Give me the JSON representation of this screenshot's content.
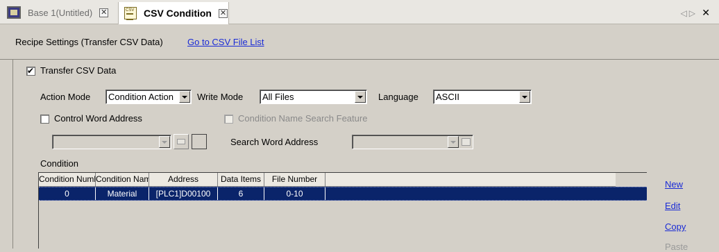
{
  "tabs": [
    {
      "label": "Base 1(Untitled)",
      "icon": "monitor-icon",
      "active": false
    },
    {
      "label": "CSV Condition",
      "icon": "csv-document-icon",
      "active": true
    }
  ],
  "nav": {
    "left": "◁",
    "right": "▷",
    "close": "✕"
  },
  "header": {
    "title": "Recipe Settings (Transfer CSV Data)",
    "link": "Go to CSV File List"
  },
  "transfer_csv": {
    "label": "Transfer CSV Data",
    "checked": true
  },
  "action_mode": {
    "label": "Action Mode",
    "value": "Condition Action"
  },
  "write_mode": {
    "label": "Write Mode",
    "value": "All Files"
  },
  "language": {
    "label": "Language",
    "value": "ASCII"
  },
  "control_word": {
    "label": "Control Word Address",
    "checked": false,
    "value": ""
  },
  "condition_search": {
    "label": "Condition Name Search Feature",
    "checked": false,
    "enabled": false
  },
  "search_word": {
    "label": "Search Word Address",
    "value": ""
  },
  "condition": {
    "label": "Condition",
    "columns": [
      "Condition Number",
      "Condition Name",
      "Address",
      "Data Items",
      "File Number"
    ],
    "rows": [
      {
        "number": "0",
        "name": "Material",
        "address": "[PLC1]D00100",
        "items": "6",
        "file": "0-10"
      }
    ]
  },
  "actions": {
    "new": "New",
    "edit": "Edit",
    "copy": "Copy",
    "paste": "Paste"
  },
  "colors": {
    "selection": "#0a246a",
    "link": "#1a2bd6",
    "background": "#d4d0c8"
  }
}
